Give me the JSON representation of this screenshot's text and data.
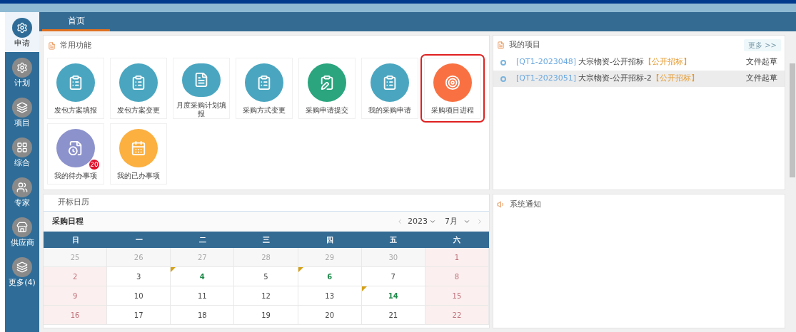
{
  "sidebar": {
    "items": [
      {
        "label": "申请",
        "selected": true
      },
      {
        "label": "计划",
        "selected": false
      },
      {
        "label": "项目",
        "selected": false
      },
      {
        "label": "综合",
        "selected": false
      },
      {
        "label": "专家",
        "selected": false
      },
      {
        "label": "供应商",
        "selected": false
      },
      {
        "label": "更多(4)",
        "selected": false
      }
    ]
  },
  "tabs": [
    {
      "label": "首页",
      "selected": true
    }
  ],
  "functions": {
    "title": "常用功能",
    "tiles": [
      {
        "label": "发包方案填报",
        "color": "#4aa6c0",
        "highlighted": false
      },
      {
        "label": "发包方案变更",
        "color": "#4aa6c0",
        "highlighted": false
      },
      {
        "label": "月度采购计划填报",
        "color": "#4aa6c0",
        "highlighted": false
      },
      {
        "label": "采购方式变更",
        "color": "#4aa6c0",
        "highlighted": false
      },
      {
        "label": "采购申请提交",
        "color": "#2aa57e",
        "highlighted": false
      },
      {
        "label": "我的采购申请",
        "color": "#4aa6c0",
        "highlighted": false
      },
      {
        "label": "采购项目进程",
        "color": "#f97142",
        "highlighted": true
      },
      {
        "label": "我的待办事项",
        "color": "#8c92cc",
        "highlighted": false,
        "badge": "20"
      },
      {
        "label": "我的已办事项",
        "color": "#fbb040",
        "highlighted": false
      }
    ]
  },
  "projects": {
    "title": "我的项目",
    "more": "更多 >>",
    "rows": [
      {
        "code": "[QT1-2023048]",
        "name": "大宗物资-公开招标",
        "type": "【公开招标】",
        "status": "文件起草",
        "selected": false
      },
      {
        "code": "[QT1-2023051]",
        "name": "大宗物资-公开招标-2",
        "type": "【公开招标】",
        "status": "文件起草",
        "selected": true
      }
    ]
  },
  "calendar": {
    "title": "开标日历",
    "subtitle": "采购日程",
    "year": "2023",
    "month": "7月",
    "weekdays": [
      "日",
      "一",
      "二",
      "三",
      "四",
      "五",
      "六"
    ],
    "weeks": [
      [
        {
          "day": "25",
          "kind": "other"
        },
        {
          "day": "26",
          "kind": "other"
        },
        {
          "day": "27",
          "kind": "other"
        },
        {
          "day": "28",
          "kind": "other"
        },
        {
          "day": "29",
          "kind": "other"
        },
        {
          "day": "30",
          "kind": "other"
        },
        {
          "day": "1",
          "kind": "weekend"
        }
      ],
      [
        {
          "day": "2",
          "kind": "weekend"
        },
        {
          "day": "3",
          "kind": "normal"
        },
        {
          "day": "4",
          "kind": "event"
        },
        {
          "day": "5",
          "kind": "normal"
        },
        {
          "day": "6",
          "kind": "event"
        },
        {
          "day": "7",
          "kind": "normal"
        },
        {
          "day": "8",
          "kind": "weekend"
        }
      ],
      [
        {
          "day": "9",
          "kind": "weekend"
        },
        {
          "day": "10",
          "kind": "normal"
        },
        {
          "day": "11",
          "kind": "normal"
        },
        {
          "day": "12",
          "kind": "normal"
        },
        {
          "day": "13",
          "kind": "normal"
        },
        {
          "day": "14",
          "kind": "event"
        },
        {
          "day": "15",
          "kind": "weekend"
        }
      ],
      [
        {
          "day": "16",
          "kind": "weekend"
        },
        {
          "day": "17",
          "kind": "normal"
        },
        {
          "day": "18",
          "kind": "normal"
        },
        {
          "day": "19",
          "kind": "normal"
        },
        {
          "day": "20",
          "kind": "normal"
        },
        {
          "day": "21",
          "kind": "normal"
        },
        {
          "day": "22",
          "kind": "weekend"
        }
      ]
    ]
  },
  "notices": {
    "title": "系统通知"
  }
}
